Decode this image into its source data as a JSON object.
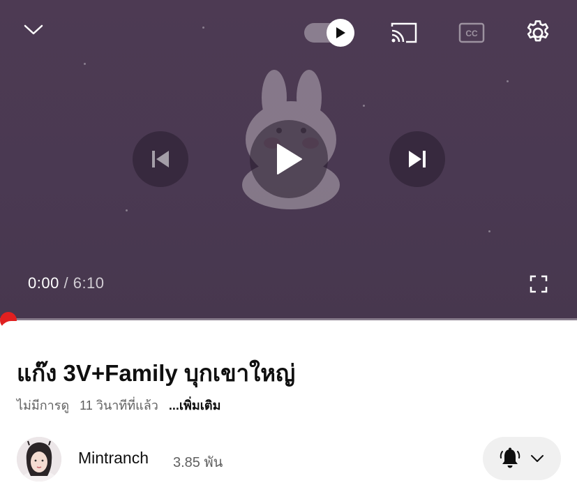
{
  "player": {
    "current_time": "0:00",
    "separator": "/",
    "duration": "6:10",
    "progress_fraction": 0.0,
    "autoplay_on": true
  },
  "icons": {
    "collapse": "chevron-down-icon",
    "autoplay": "autoplay-toggle-icon",
    "cast": "cast-icon",
    "captions": "closed-captions-icon",
    "settings": "gear-icon",
    "previous": "skip-previous-icon",
    "play": "play-icon",
    "next": "skip-next-icon",
    "fullscreen": "fullscreen-icon",
    "notifications": "bell-icon",
    "subscribe_menu": "chevron-down-icon"
  },
  "video": {
    "title": "แก๊ง 3V+Family บุกเขาใหญ่",
    "views": "ไม่มีการดู",
    "uploaded": "11 วินาทีที่แล้ว",
    "more_label": "...เพิ่มเติม"
  },
  "channel": {
    "name": "Mintranch",
    "subscribers": "3.85 พัน"
  },
  "colors": {
    "player_bg": "#4a3952",
    "progress": "#ff0000",
    "progress_dot": "#e02020",
    "text_primary": "#0f0f0f",
    "text_secondary": "#606060"
  }
}
